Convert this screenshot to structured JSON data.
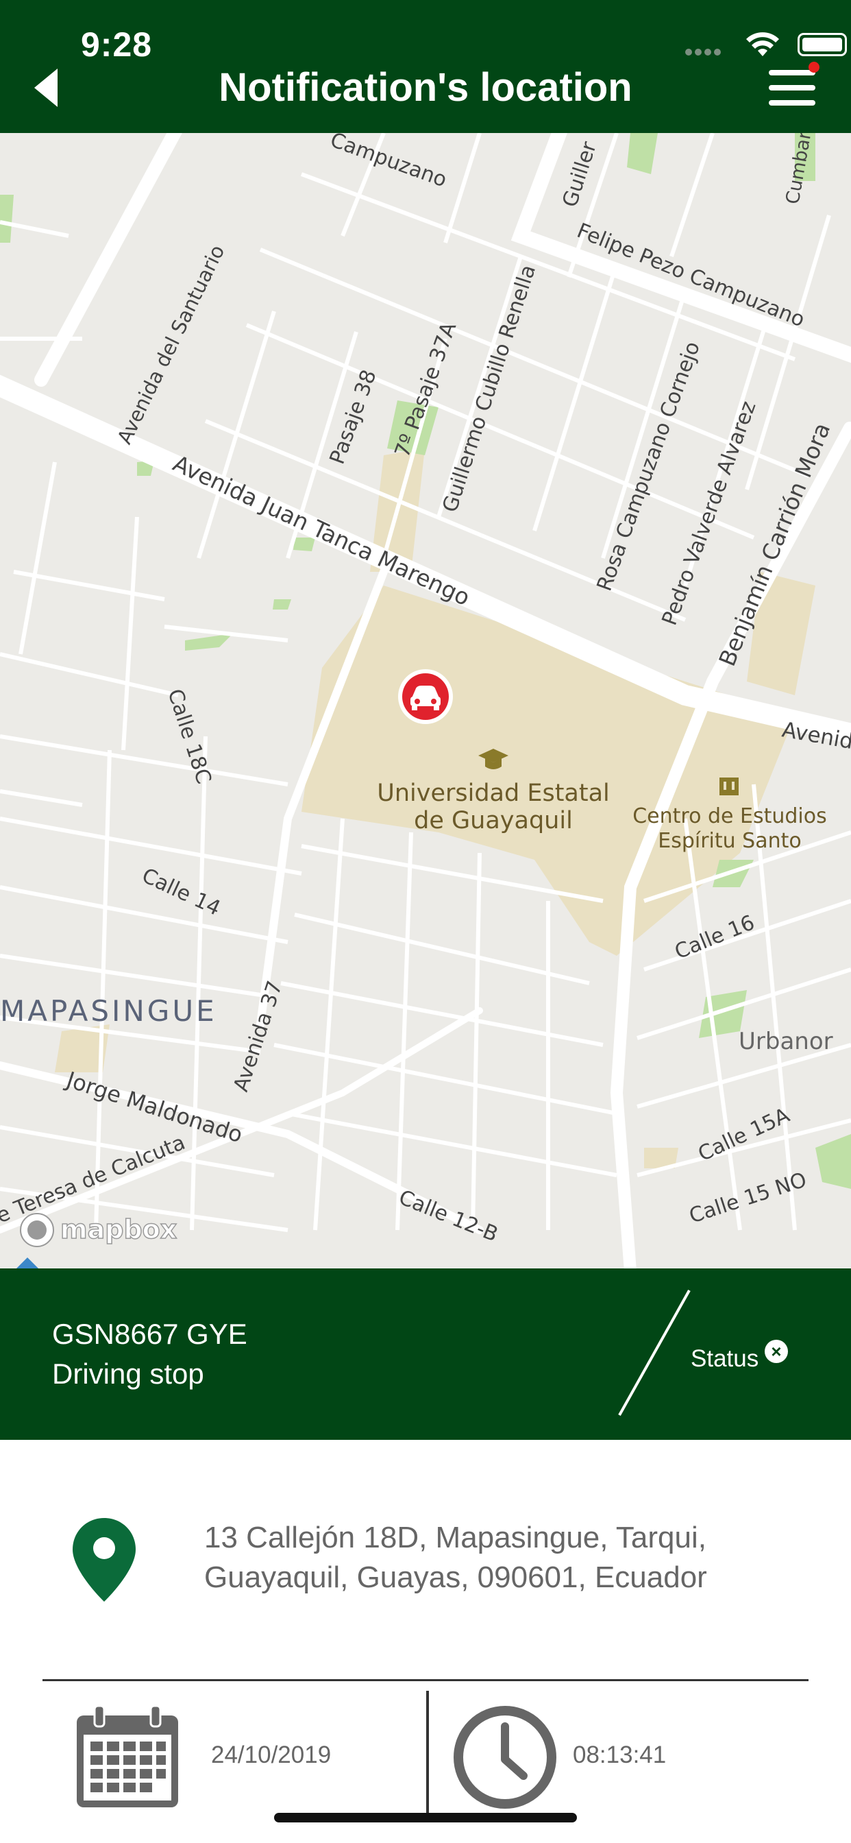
{
  "status_bar": {
    "time": "9:28"
  },
  "header": {
    "title": "Notification's location"
  },
  "map": {
    "attribution": "mapbox",
    "labels": {
      "poi_university_line1": "Universidad Estatal",
      "poi_university_line2": "de Guayaquil",
      "poi_school_line1": "Centro de Estudios",
      "poi_school_line2": "Espíritu Santo",
      "neighborhood_mapasingue": "MAPASINGUE",
      "neighborhood_urbanor": "Urbanor",
      "street_juan_tanca": "Avenida Juan Tanca Marengo",
      "street_felipe_pezo": "Felipe Pezo Campuzano",
      "street_campuzano_top": "Campuzano",
      "street_santuario": "Avenida del Santuario",
      "street_pasaje38": "Pasaje 38",
      "street_pasaje37a": "7º Pasaje 37A",
      "street_cubillo": "Guillermo Cubillo Renella",
      "street_guiller": "Guiller",
      "street_cumbaratza": "Cumbarat",
      "street_rosa": "Rosa Campuzano Cornejo",
      "street_pedro": "Pedro Valverde Alvarez",
      "street_benjamin": "Benjamín Carrión Mora",
      "street_avenid": "Avenid",
      "street_calle18c": "Calle 18C",
      "street_calle14": "Calle 14",
      "street_calle16": "Calle 16",
      "street_avenida37": "Avenida 37",
      "street_jorge": "Jorge Maldonado",
      "street_teresa": "e Teresa de Calcuta",
      "street_calle12b": "Calle 12-B",
      "street_calle15a": "Calle 15A",
      "street_calle15no": "Calle 15 NO"
    }
  },
  "info": {
    "plate": "GSN8667 GYE",
    "event": "Driving stop",
    "status_label": "Status",
    "close_symbol": "×"
  },
  "address": {
    "line1": "13 Callejón 18D, Mapasingue, Tarqui,",
    "line2": "Guayaquil, Guayas, 090601, Ecuador"
  },
  "datetime": {
    "date": "24/10/2019",
    "time": "08:13:41"
  },
  "colors": {
    "brand_green": "#014615",
    "marker_red": "#e0222d",
    "pin_green": "#0b6b3a"
  }
}
